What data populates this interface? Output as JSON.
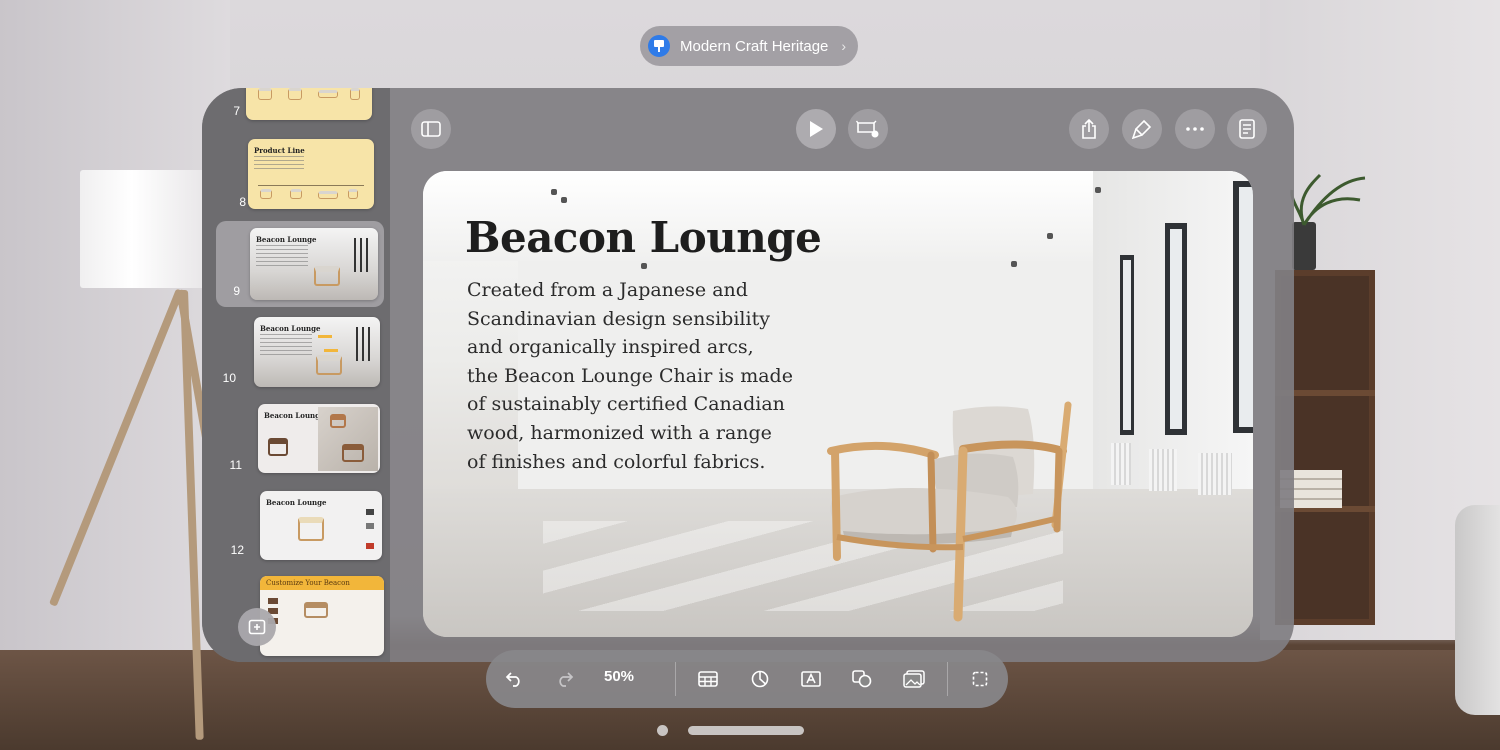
{
  "window": {
    "title": "Modern Craft Heritage"
  },
  "sidebar": {
    "slides": [
      {
        "number": "7"
      },
      {
        "number": "8",
        "title": "Product Line"
      },
      {
        "number": "9",
        "title": "Beacon Lounge",
        "selected": true
      },
      {
        "number": "10",
        "title": "Beacon Lounge"
      },
      {
        "number": "11",
        "title": "Beacon Lounge"
      },
      {
        "number": "12",
        "title": "Beacon Lounge"
      },
      {
        "number": "",
        "title": "Customize Your Beacon"
      }
    ]
  },
  "toolbar_top": {
    "icons": [
      "sidebar-toggle-icon",
      "play-icon",
      "present-remote-icon",
      "share-icon",
      "format-brush-icon",
      "more-icon",
      "presenter-notes-icon"
    ]
  },
  "slide": {
    "title": "Beacon Lounge",
    "body_lines": [
      "Created from a Japanese and",
      "Scandinavian design sensibility",
      "and organically inspired arcs,",
      "the Beacon Lounge Chair is made",
      "of sustainably certified Canadian",
      "wood, harmonized with a range",
      "of finishes and colorful fabrics."
    ]
  },
  "toolbar_bottom": {
    "zoom": "50%",
    "icons": [
      "undo-icon",
      "redo-icon",
      "table-icon",
      "chart-icon",
      "text-box-icon",
      "shape-icon",
      "media-icon",
      "select-icon"
    ]
  },
  "colors": {
    "accent": "#2f7be8",
    "slide_thumb_cream": "#f7e4a8",
    "wood": "#d3a36a"
  }
}
